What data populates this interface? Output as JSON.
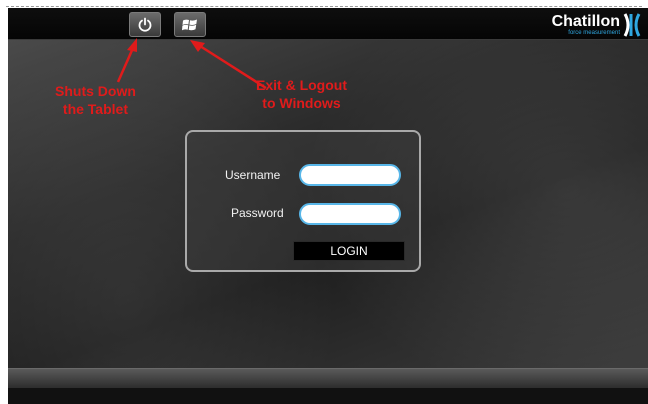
{
  "top_bar": {
    "power_button_icon": "power-icon",
    "windows_button_icon": "windows-logo-icon"
  },
  "logo": {
    "name": "Chatillon",
    "tagline": "force measurement",
    "mark_icon": "chatillon-mark-icon",
    "accent_color": "#2fa7e0"
  },
  "login": {
    "username_label": "Username",
    "username_value": "",
    "password_label": "Password",
    "password_value": "",
    "login_button": "LOGIN"
  },
  "annotations": {
    "shutdown_line1": "Shuts Down",
    "shutdown_line2": "the Tablet",
    "exit_line1": "Exit & Logout",
    "exit_line2": "to Windows",
    "color": "#e01b1b"
  }
}
